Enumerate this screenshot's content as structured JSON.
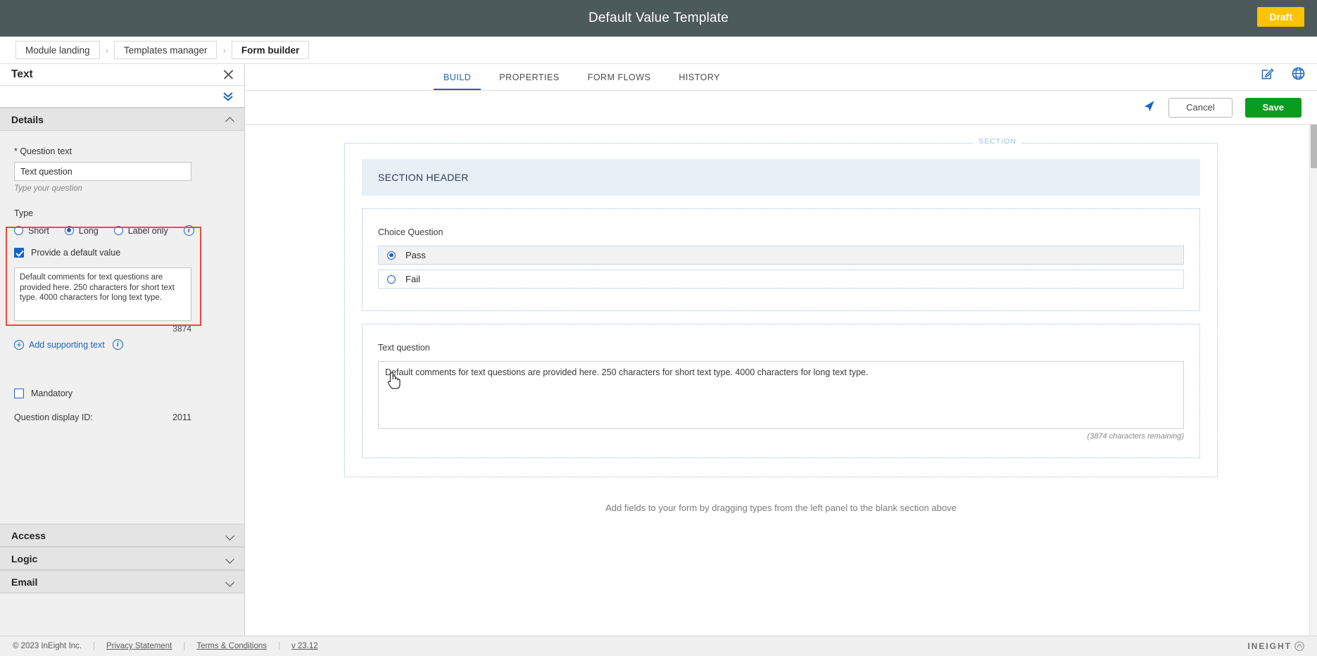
{
  "titlebar": {
    "title": "Default Value Template",
    "status_badge": "Draft"
  },
  "breadcrumb": {
    "items": [
      {
        "label": "Module landing"
      },
      {
        "label": "Templates manager"
      },
      {
        "label": "Form builder"
      }
    ],
    "separator": "›"
  },
  "left_panel": {
    "title": "Text",
    "close_icon": "close-icon",
    "collapse_all_icon": "double-chevron-down-icon",
    "sections": {
      "details": {
        "title": "Details",
        "question_text_label": "* Question text",
        "question_text_value": "Text question",
        "question_text_placeholder": "Type your question",
        "question_text_hint": "Type your question",
        "type_label": "Type",
        "type_options": [
          {
            "label": "Short",
            "selected": false
          },
          {
            "label": "Long",
            "selected": true
          },
          {
            "label": "Label only",
            "selected": false
          }
        ],
        "type_info_icon": "info-icon",
        "default_value_checkbox_label": "Provide a default value",
        "default_value_checked": true,
        "default_value_text": "Default comments for text questions are provided here. 250 characters for short text type. 4000 characters for long text type.",
        "default_value_count": "3874",
        "add_supporting_text_label": "Add supporting text",
        "add_supporting_text_info_icon": "info-icon",
        "mandatory_label": "Mandatory",
        "mandatory_checked": false,
        "question_display_id_label": "Question display ID:",
        "question_display_id_value": "2011"
      },
      "access": {
        "title": "Access"
      },
      "logic": {
        "title": "Logic"
      },
      "email": {
        "title": "Email"
      }
    }
  },
  "main": {
    "tabs": [
      {
        "label": "BUILD",
        "active": true
      },
      {
        "label": "PROPERTIES",
        "active": false
      },
      {
        "label": "FORM FLOWS",
        "active": false
      },
      {
        "label": "HISTORY",
        "active": false
      }
    ],
    "tab_icons": [
      {
        "name": "edit-pencil-icon"
      },
      {
        "name": "globe-icon"
      }
    ],
    "actionbar": {
      "send_icon": "send-arrow-icon",
      "cancel_label": "Cancel",
      "save_label": "Save"
    },
    "canvas": {
      "section_tag": "SECTION",
      "section_header": "SECTION HEADER",
      "choice_question": {
        "label": "Choice Question",
        "options": [
          {
            "label": "Pass",
            "selected": true
          },
          {
            "label": "Fail",
            "selected": false
          }
        ]
      },
      "text_question": {
        "label": "Text question",
        "value": "Default comments for text questions are provided here. 250 characters for short text type. 4000 characters for long text type.",
        "remaining": "(3874 characters remaining)",
        "cursor_icon": "hand-pointer-cursor"
      },
      "note": "Add fields to your form by dragging types from the left panel to the blank section above"
    }
  },
  "footer": {
    "copyright": "© 2023 InEight Inc.",
    "links": [
      {
        "label": "Privacy Statement"
      },
      {
        "label": "Terms & Conditions"
      },
      {
        "label": "v 23.12"
      }
    ],
    "brand": "INEIGHT"
  },
  "colors": {
    "titlebar_bg": "#4c5a5c",
    "draft_badge": "#fdc300",
    "accent_blue": "#1a62c4",
    "save_green": "#0a9c1f",
    "highlight_red": "#f4473c",
    "section_header_bg": "#e7eff7"
  }
}
